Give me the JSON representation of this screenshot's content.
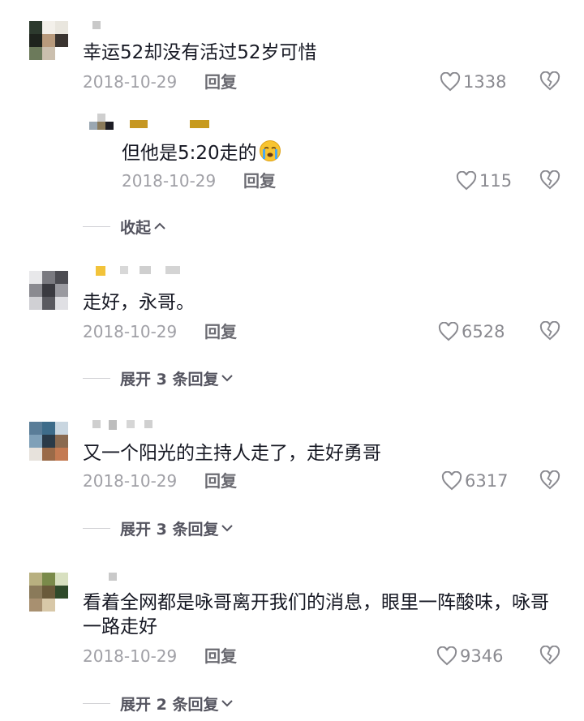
{
  "colors": {
    "text": "#161823",
    "meta": "#a0a0a6",
    "accent": "#6b6b72"
  },
  "comments": [
    {
      "text": "幸运52却没有活过52岁可惜",
      "date": "2018-10-29",
      "reply_label": "回复",
      "likes": "1338",
      "sub_reply": {
        "text": "但他是5:20走的",
        "emoji": "crying-face-emoji",
        "date": "2018-10-29",
        "reply_label": "回复",
        "likes": "115"
      },
      "collapse_label": "收起"
    },
    {
      "text": "走好，永哥。",
      "date": "2018-10-29",
      "reply_label": "回复",
      "likes": "6528",
      "expand_label": "展开 3 条回复"
    },
    {
      "text": "又一个阳光的主持人走了，走好勇哥",
      "date": "2018-10-29",
      "reply_label": "回复",
      "likes": "6317",
      "expand_label": "展开 3 条回复"
    },
    {
      "text": "看着全网都是咏哥离开我们的消息，眼里一阵酸味，咏哥一路走好",
      "date": "2018-10-29",
      "reply_label": "回复",
      "likes": "9346",
      "expand_label": "展开 2 条回复"
    }
  ]
}
